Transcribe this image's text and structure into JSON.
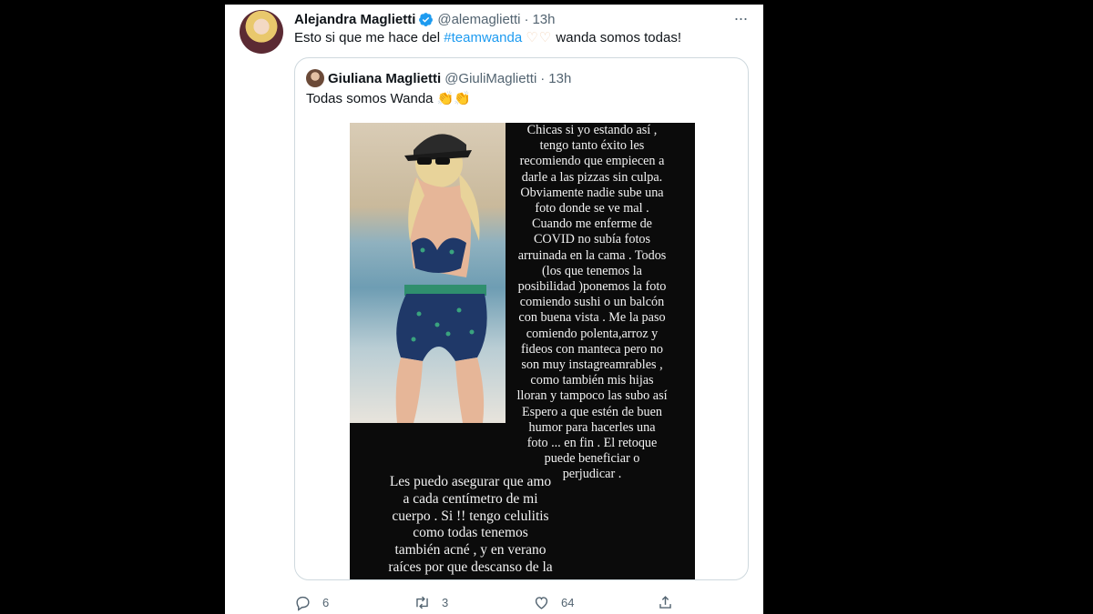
{
  "tweet": {
    "author": {
      "display_name": "Alejandra Maglietti",
      "handle": "@alemaglietti",
      "verified": true,
      "time": "13h"
    },
    "text_before": "Esto si que me hace del",
    "hashtag": "#teamwanda",
    "hearts": "♡♡",
    "text_after": "wanda somos todas!",
    "more_icon": "more-icon"
  },
  "quoted": {
    "author": {
      "display_name": "Giuliana Maglietti",
      "handle": "@GiuliMaglietti",
      "time": "13h"
    },
    "text": "Todas somos Wanda",
    "emoji": "👏👏",
    "story_text_block1": [
      "Chicas si yo  estando así ,",
      "tengo tanto éxito les",
      "recomiendo que empiecen a",
      "darle a las pizzas sin culpa.",
      "Obviamente nadie sube una",
      "foto donde se ve mal .",
      "Cuando me enferme de",
      "COVID no subía fotos",
      "arruinada en la cama . Todos",
      "(los que tenemos la",
      "posibilidad )ponemos la foto",
      "comiendo sushi o un balcón",
      "con buena vista  . Me la paso",
      "comiendo polenta,arroz y",
      "fideos con manteca  pero no",
      "son muy instagreamrables ,",
      "como también mis hijas",
      "lloran y tampoco las subo así",
      "Espero a que estén de buen",
      "humor  para hacerles una",
      "foto ... en fin  . El retoque",
      "puede beneficiar o",
      "perjudicar ."
    ],
    "story_text_block2": [
      "Les puedo asegurar  que amo",
      "a cada centímetro de mi",
      "cuerpo . Si !! tengo celulitis",
      "como todas tenemos",
      "también acné , y en verano",
      "raíces por que descanso de la"
    ]
  },
  "actions": {
    "reply_count": "6",
    "retweet_count": "3",
    "like_count": "64"
  },
  "colors": {
    "link": "#1d9bf0",
    "secondary_text": "#536471",
    "border": "#cfd9de"
  }
}
